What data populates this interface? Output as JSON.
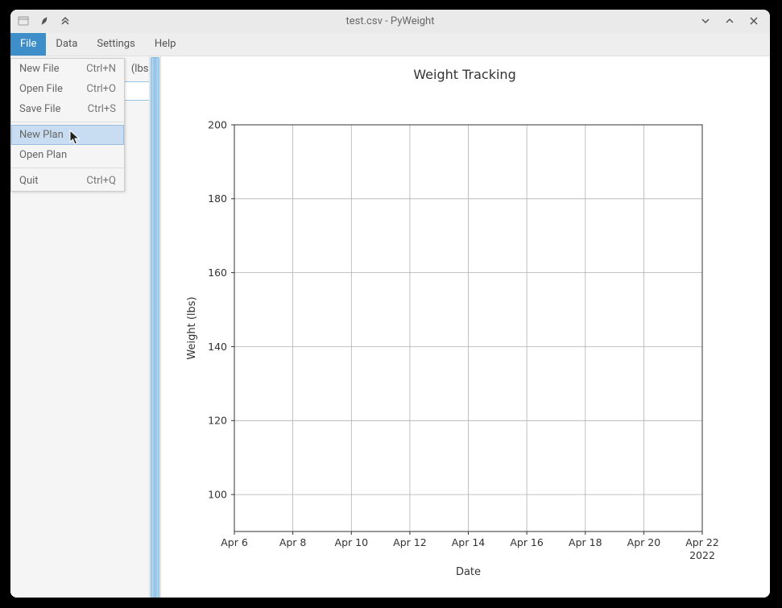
{
  "window": {
    "title": "test.csv - PyWeight"
  },
  "menubar": {
    "items": [
      {
        "label": "File",
        "active": true
      },
      {
        "label": "Data",
        "active": false
      },
      {
        "label": "Settings",
        "active": false
      },
      {
        "label": "Help",
        "active": false
      }
    ]
  },
  "dropdown": {
    "items": [
      {
        "label": "New File",
        "shortcut": "Ctrl+N",
        "highlighted": false
      },
      {
        "label": "Open File",
        "shortcut": "Ctrl+O",
        "highlighted": false
      },
      {
        "label": "Save File",
        "shortcut": "Ctrl+S",
        "highlighted": false
      },
      {
        "separator": true
      },
      {
        "label": "New Plan",
        "shortcut": "",
        "highlighted": true
      },
      {
        "label": "Open Plan",
        "shortcut": "",
        "highlighted": false
      },
      {
        "separator": true
      },
      {
        "label": "Quit",
        "shortcut": "Ctrl+Q",
        "highlighted": false
      }
    ]
  },
  "sidebar": {
    "header": "(lbs)"
  },
  "chart_data": {
    "type": "line",
    "title": "Weight Tracking",
    "xlabel": "Date",
    "ylabel": "Weight (lbs)",
    "x_ticks": [
      "Apr 6",
      "Apr 8",
      "Apr 10",
      "Apr 12",
      "Apr 14",
      "Apr 16",
      "Apr 18",
      "Apr 20",
      "Apr 22"
    ],
    "x_year": "2022",
    "y_ticks": [
      100,
      120,
      140,
      160,
      180,
      200
    ],
    "ylim": [
      90,
      200
    ],
    "series": []
  }
}
